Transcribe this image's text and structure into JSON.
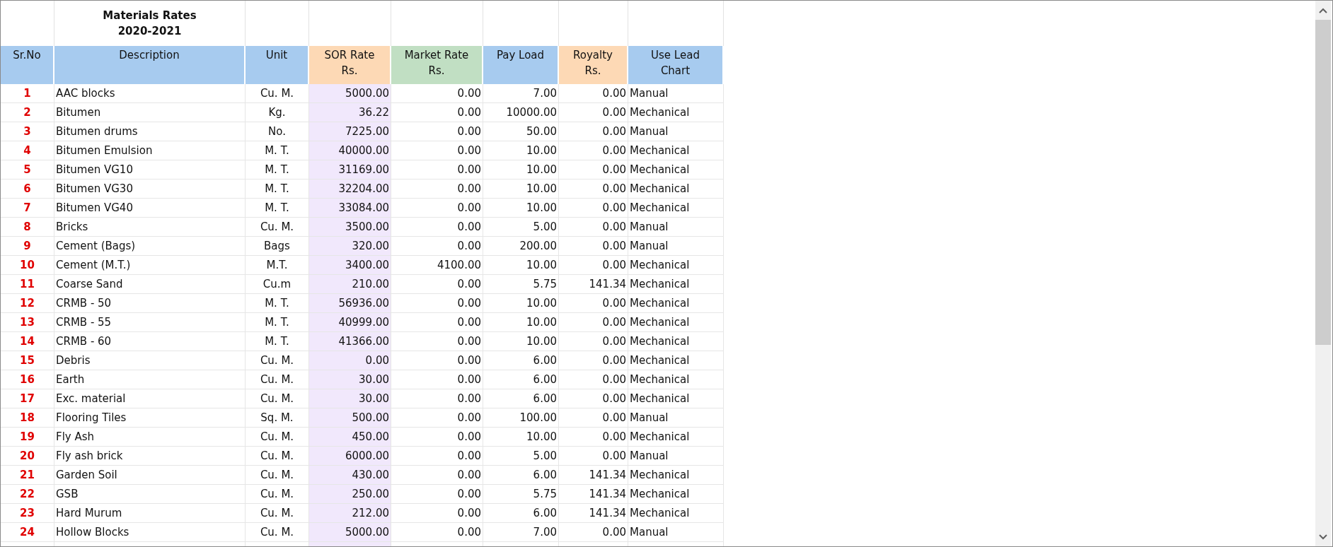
{
  "title": "Materials Rates\n2020-2021",
  "columns": [
    {
      "label": "Sr.No",
      "kind": "plain"
    },
    {
      "label": "Description",
      "kind": "plain"
    },
    {
      "label": "Unit",
      "kind": "plain"
    },
    {
      "label": "SOR Rate\nRs.",
      "kind": "rate"
    },
    {
      "label": "Market Rate\nRs.",
      "kind": "market"
    },
    {
      "label": "Pay Load",
      "kind": "plain"
    },
    {
      "label": "Royalty\nRs.",
      "kind": "rate"
    },
    {
      "label": "Use Lead\nChart",
      "kind": "plain"
    }
  ],
  "rows": [
    [
      "1",
      "AAC blocks",
      "Cu. M.",
      "5000.00",
      "0.00",
      "7.00",
      "0.00",
      "Manual"
    ],
    [
      "2",
      "Bitumen",
      "Kg.",
      "36.22",
      "0.00",
      "10000.00",
      "0.00",
      "Mechanical"
    ],
    [
      "3",
      "Bitumen drums",
      "No.",
      "7225.00",
      "0.00",
      "50.00",
      "0.00",
      "Manual"
    ],
    [
      "4",
      "Bitumen Emulsion",
      "M. T.",
      "40000.00",
      "0.00",
      "10.00",
      "0.00",
      "Mechanical"
    ],
    [
      "5",
      "Bitumen VG10",
      "M. T.",
      "31169.00",
      "0.00",
      "10.00",
      "0.00",
      "Mechanical"
    ],
    [
      "6",
      "Bitumen VG30",
      "M. T.",
      "32204.00",
      "0.00",
      "10.00",
      "0.00",
      "Mechanical"
    ],
    [
      "7",
      "Bitumen VG40",
      "M. T.",
      "33084.00",
      "0.00",
      "10.00",
      "0.00",
      "Mechanical"
    ],
    [
      "8",
      "Bricks",
      "Cu. M.",
      "3500.00",
      "0.00",
      "5.00",
      "0.00",
      "Manual"
    ],
    [
      "9",
      "Cement (Bags)",
      "Bags",
      "320.00",
      "0.00",
      "200.00",
      "0.00",
      "Manual"
    ],
    [
      "10",
      "Cement (M.T.)",
      "M.T.",
      "3400.00",
      "4100.00",
      "10.00",
      "0.00",
      "Mechanical"
    ],
    [
      "11",
      "Coarse Sand",
      "Cu.m",
      "210.00",
      "0.00",
      "5.75",
      "141.34",
      "Mechanical"
    ],
    [
      "12",
      "CRMB - 50",
      "M. T.",
      "56936.00",
      "0.00",
      "10.00",
      "0.00",
      "Mechanical"
    ],
    [
      "13",
      "CRMB - 55",
      "M. T.",
      "40999.00",
      "0.00",
      "10.00",
      "0.00",
      "Mechanical"
    ],
    [
      "14",
      "CRMB - 60",
      "M. T.",
      "41366.00",
      "0.00",
      "10.00",
      "0.00",
      "Mechanical"
    ],
    [
      "15",
      "Debris",
      "Cu. M.",
      "0.00",
      "0.00",
      "6.00",
      "0.00",
      "Mechanical"
    ],
    [
      "16",
      "Earth",
      "Cu. M.",
      "30.00",
      "0.00",
      "6.00",
      "0.00",
      "Mechanical"
    ],
    [
      "17",
      "Exc. material",
      "Cu. M.",
      "30.00",
      "0.00",
      "6.00",
      "0.00",
      "Mechanical"
    ],
    [
      "18",
      "Flooring Tiles",
      "Sq. M.",
      "500.00",
      "0.00",
      "100.00",
      "0.00",
      "Manual"
    ],
    [
      "19",
      "Fly Ash",
      "Cu. M.",
      "450.00",
      "0.00",
      "10.00",
      "0.00",
      "Mechanical"
    ],
    [
      "20",
      "Fly ash brick",
      "Cu. M.",
      "6000.00",
      "0.00",
      "5.00",
      "0.00",
      "Manual"
    ],
    [
      "21",
      "Garden Soil",
      "Cu. M.",
      "430.00",
      "0.00",
      "6.00",
      "141.34",
      "Mechanical"
    ],
    [
      "22",
      "GSB",
      "Cu. M.",
      "250.00",
      "0.00",
      "5.75",
      "141.34",
      "Mechanical"
    ],
    [
      "23",
      "Hard Murum",
      "Cu. M.",
      "212.00",
      "0.00",
      "6.00",
      "141.34",
      "Mechanical"
    ],
    [
      "24",
      "Hollow Blocks",
      "Cu. M.",
      "5000.00",
      "0.00",
      "7.00",
      "0.00",
      "Manual"
    ]
  ]
}
